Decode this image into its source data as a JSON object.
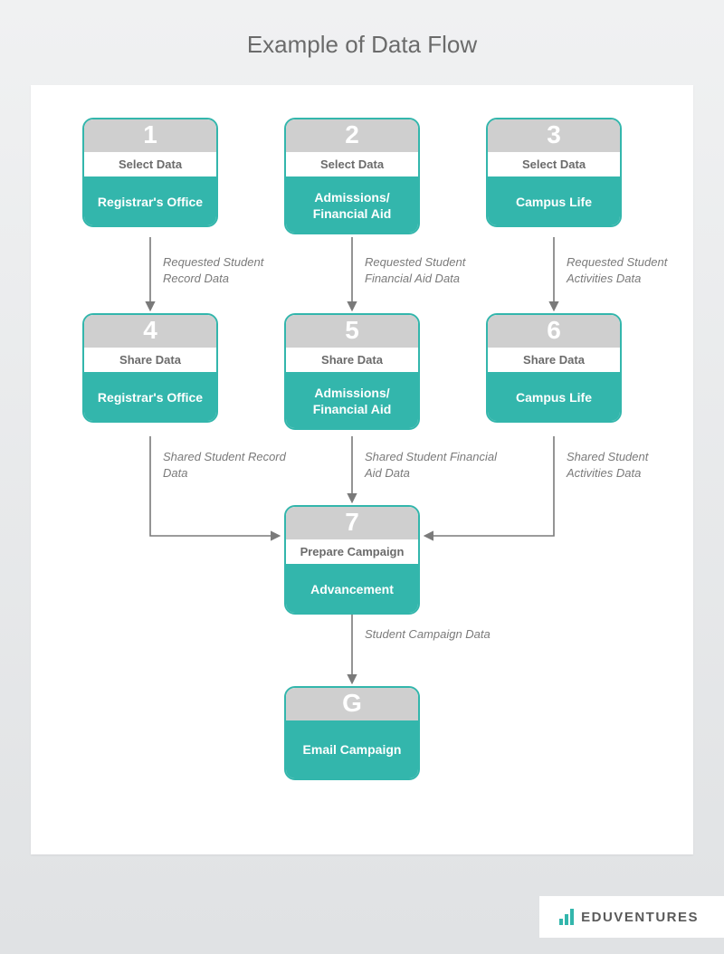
{
  "title": "Example of Data Flow",
  "logo": "EDUVENTURES",
  "nodes": {
    "n1": {
      "num": "1",
      "action": "Select Data",
      "body": "Registrar's Office"
    },
    "n2": {
      "num": "2",
      "action": "Select Data",
      "body": "Admissions/ Financial Aid"
    },
    "n3": {
      "num": "3",
      "action": "Select Data",
      "body": "Campus Life"
    },
    "n4": {
      "num": "4",
      "action": "Share Data",
      "body": "Registrar's Office"
    },
    "n5": {
      "num": "5",
      "action": "Share Data",
      "body": "Admissions/ Financial Aid"
    },
    "n6": {
      "num": "6",
      "action": "Share Data",
      "body": "Campus Life"
    },
    "n7": {
      "num": "7",
      "action": "Prepare Campaign",
      "body": "Advancement"
    },
    "g": {
      "num": "G",
      "body": "Email Campaign"
    }
  },
  "edges": {
    "e14": "Requested Student Record Data",
    "e25": "Requested Student Financial Aid Data",
    "e36": "Requested Student Activities Data",
    "e47": "Shared Student Record Data",
    "e57": "Shared Student Financial Aid Data",
    "e67": "Shared Student Activities Data",
    "e7g": "Student Campaign Data"
  }
}
